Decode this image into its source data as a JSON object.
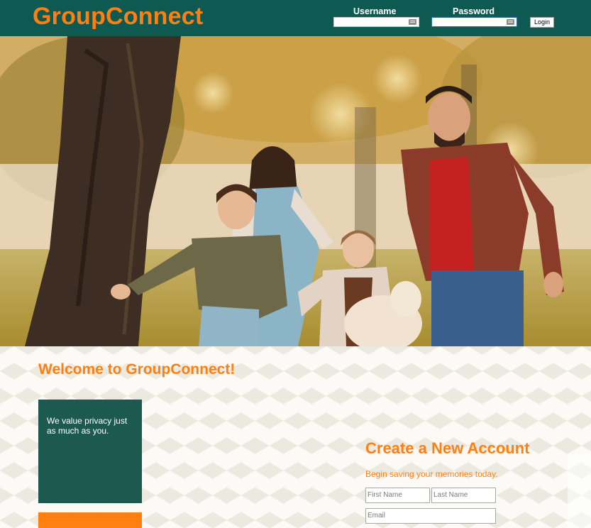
{
  "header": {
    "brand": "GroupConnect",
    "username_label": "Username",
    "password_label": "Password",
    "login_label": "Login",
    "username_value": "",
    "password_value": ""
  },
  "hero": {
    "icon": "family-photo"
  },
  "main": {
    "welcome_title": "Welcome to GroupConnect!",
    "privacy_text": "We value privacy just as much as you."
  },
  "signup": {
    "title": "Create a New Account",
    "subtitle": "Begin saving your memories today.",
    "first_name_placeholder": "First Name",
    "last_name_placeholder": "Last Name",
    "email_placeholder": "Email"
  },
  "colors": {
    "brand_orange": "#ff7f11",
    "header_teal": "#0e5a52",
    "box_teal": "#1c5a50"
  }
}
